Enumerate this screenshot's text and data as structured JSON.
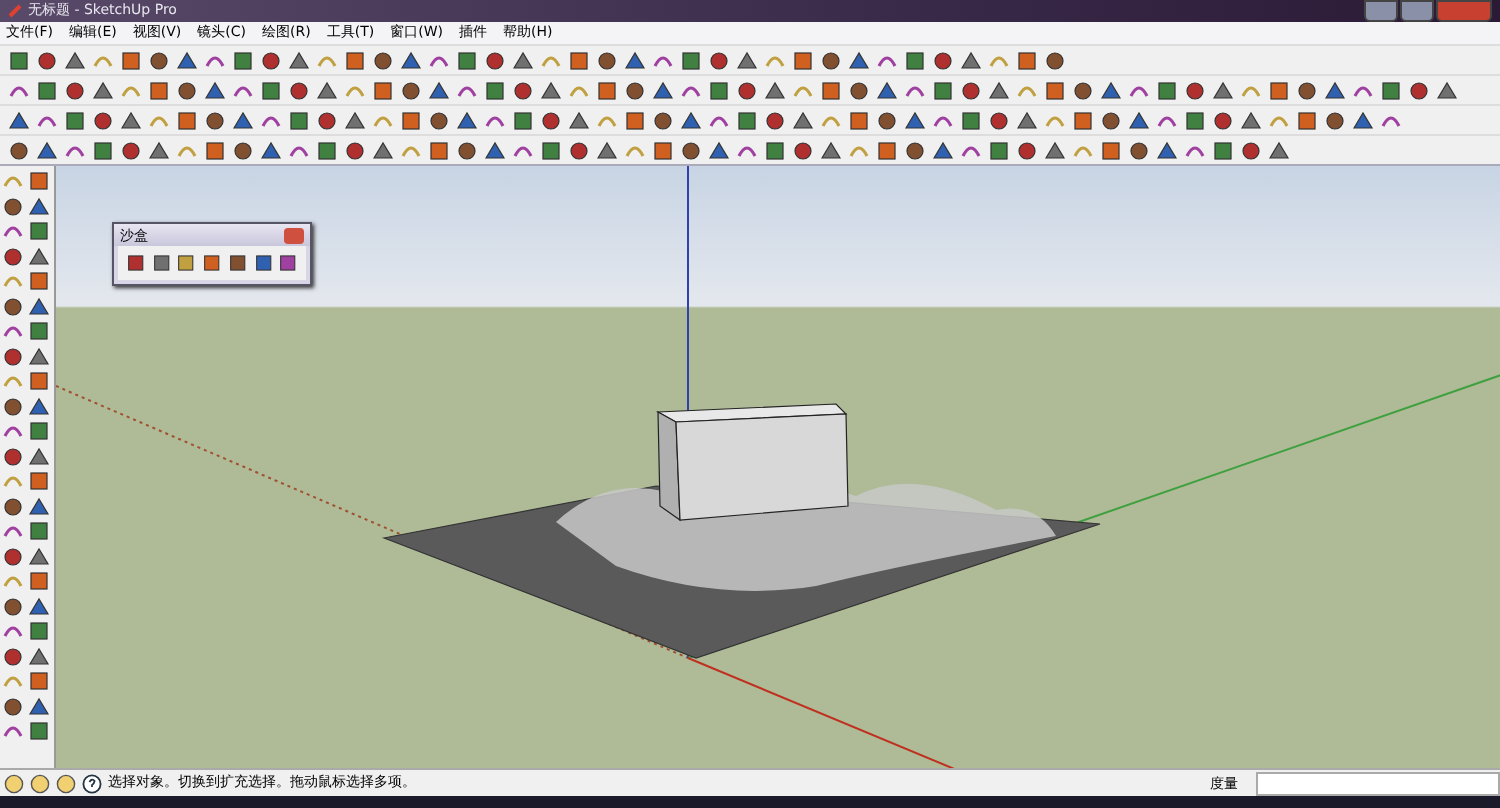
{
  "window": {
    "title": "无标题 - SketchUp Pro"
  },
  "menu": [
    "文件(F)",
    "编辑(E)",
    "视图(V)",
    "镜头(C)",
    "绘图(R)",
    "工具(T)",
    "窗口(W)",
    "插件",
    "帮助(H)"
  ],
  "sandbox_panel": {
    "title": "沙盒"
  },
  "status_bar": {
    "message": "选择对象。切换到扩充选择。拖动鼠标选择多项。",
    "measurement_label": "度量"
  }
}
